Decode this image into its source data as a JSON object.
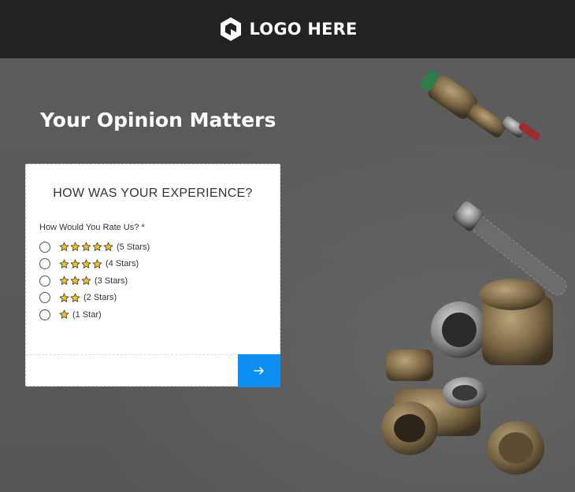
{
  "header": {
    "logo_text": "LOGO HERE"
  },
  "hero": {
    "title": "Your Opinion Matters"
  },
  "form": {
    "heading": "HOW WAS YOUR EXPERIENCE?",
    "question": "How Would You Rate Us? *",
    "options": [
      {
        "stars": 5,
        "label": "(5 Stars)"
      },
      {
        "stars": 4,
        "label": "(4 Stars)"
      },
      {
        "stars": 3,
        "label": "(3 Stars)"
      },
      {
        "stars": 2,
        "label": "(2 Stars)"
      },
      {
        "stars": 1,
        "label": "(1 Star)"
      }
    ],
    "submit_icon": "arrow-right-icon"
  },
  "colors": {
    "header_bg": "#222222",
    "accent": "#0d8ef2",
    "star_fill": "#f5c31c"
  }
}
